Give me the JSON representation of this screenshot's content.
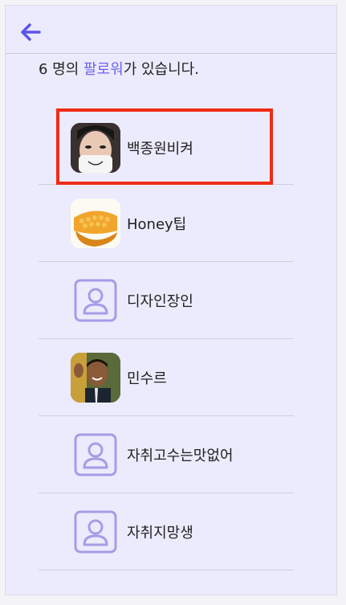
{
  "header": {
    "back_icon": "arrow-left-icon"
  },
  "summary": {
    "prefix": "6 명의 ",
    "accent": "팔로워",
    "suffix": "가 있습니다."
  },
  "followers": [
    {
      "name": "백종원비켜",
      "avatar": "photo-face-mask"
    },
    {
      "name": "Honey팁",
      "avatar": "photo-honeycomb"
    },
    {
      "name": "디자인장인",
      "avatar": "default-user-icon"
    },
    {
      "name": "민수르",
      "avatar": "photo-man-waving"
    },
    {
      "name": "자취고수는맛없어",
      "avatar": "default-user-icon"
    },
    {
      "name": "자취지망생",
      "avatar": "default-user-icon"
    }
  ],
  "colors": {
    "accent": "#6c62e8",
    "highlight": "#ef2b16",
    "panel": "#ebebfd"
  }
}
